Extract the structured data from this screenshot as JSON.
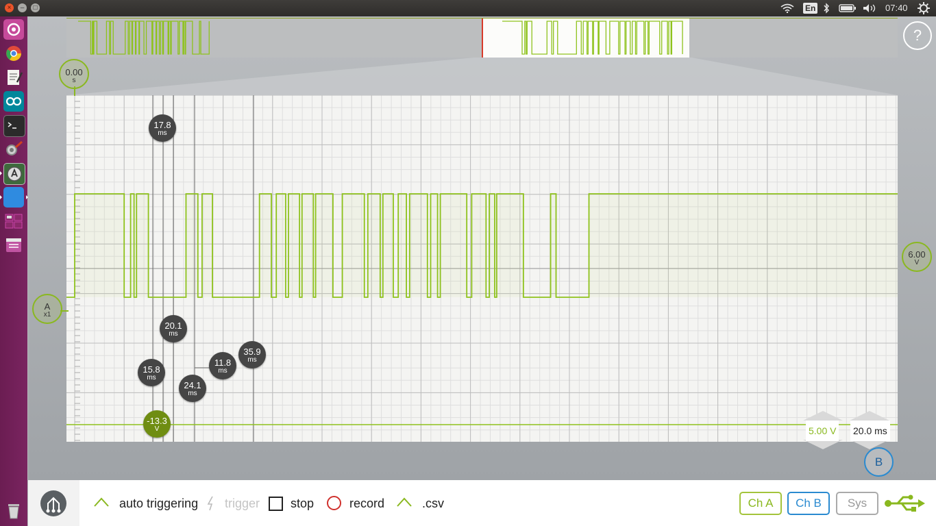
{
  "window": {
    "close_glyph": "×",
    "min_glyph": "–",
    "max_glyph": "□"
  },
  "tray": {
    "language": "En",
    "clock": "07:40"
  },
  "launcher": {
    "items": [
      "Ubuntu dash",
      "Chromium",
      "Text editor",
      "Arduino",
      "Terminal",
      "System settings",
      "Software updater",
      "Blue app",
      "Workspaces",
      "Window app",
      "Trash"
    ]
  },
  "timebase_marker": {
    "value": "0.00",
    "unit": "s"
  },
  "channel_a": {
    "name": "A",
    "gain": "x1"
  },
  "voltage_offset": {
    "value": "6.00",
    "unit": "V"
  },
  "measurements": [
    {
      "value": "17.8",
      "unit": "ms"
    },
    {
      "value": "20.1",
      "unit": "ms"
    },
    {
      "value": "15.8",
      "unit": "ms"
    },
    {
      "value": "24.1",
      "unit": "ms"
    },
    {
      "value": "11.8",
      "unit": "ms"
    },
    {
      "value": "35.9",
      "unit": "ms"
    }
  ],
  "trigger_level": {
    "value": "-13.3",
    "unit": "V"
  },
  "scale": {
    "volts_per_div": "5.00 V",
    "time_per_div": "20.0 ms"
  },
  "channel_b": {
    "name": "B"
  },
  "help_glyph": "?",
  "toolbar": {
    "auto_triggering": "auto triggering",
    "trigger": "trigger",
    "stop": "stop",
    "record": "record",
    "csv": ".csv",
    "ch_a": "Ch A",
    "ch_b": "Ch B",
    "sys": "Sys"
  },
  "colors": {
    "signal": "#8ec21c",
    "launcher": "#74215a",
    "ch_b": "#2a8ad0",
    "record": "#d0312d"
  },
  "waveform": {
    "high_level": 1,
    "low_level": 0,
    "transitions_ms": [
      0,
      20,
      22.6,
      24,
      25,
      29.8,
      45,
      49.8,
      51.5,
      55.7,
      74.7,
      79.5,
      81.5,
      85.3,
      86.4,
      90.9,
      91.9,
      96.5,
      97.4,
      104.4,
      108.2,
      117.1,
      118.5,
      123.5,
      124.6,
      128.8,
      130.8,
      134.1,
      135.4,
      142.6,
      143.9,
      146.7,
      147.8,
      158.5,
      160.5,
      166.3,
      167.6,
      169.8,
      170.6,
      181.4,
      192.4,
      194.6,
      207.9
    ]
  }
}
